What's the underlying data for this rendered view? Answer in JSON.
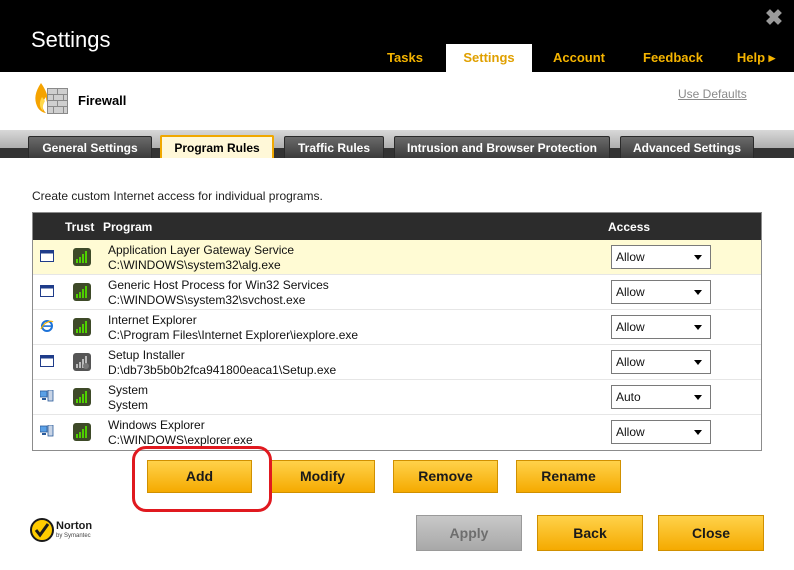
{
  "window": {
    "title": "Settings"
  },
  "top_tabs": [
    {
      "label": "Tasks"
    },
    {
      "label": "Settings"
    },
    {
      "label": "Account"
    },
    {
      "label": "Feedback"
    },
    {
      "label": "Help ▸"
    }
  ],
  "header": {
    "title": "Firewall",
    "use_defaults": "Use Defaults"
  },
  "sub_tabs": [
    {
      "label": "General Settings"
    },
    {
      "label": "Program Rules"
    },
    {
      "label": "Traffic Rules"
    },
    {
      "label": "Intrusion and Browser Protection"
    },
    {
      "label": "Advanced Settings"
    }
  ],
  "intro": "Create custom Internet access for individual programs.",
  "table": {
    "headers": {
      "trust": "Trust",
      "program": "Program",
      "access": "Access"
    },
    "rows": [
      {
        "name": "Application Layer Gateway Service",
        "path": "C:\\WINDOWS\\system32\\alg.exe",
        "access": "Allow",
        "icon": "window-icon"
      },
      {
        "name": "Generic Host Process for Win32 Services",
        "path": "C:\\WINDOWS\\system32\\svchost.exe",
        "access": "Allow",
        "icon": "window-icon"
      },
      {
        "name": "Internet Explorer",
        "path": "C:\\Program Files\\Internet Explorer\\iexplore.exe",
        "access": "Allow",
        "icon": "internet-explorer-icon"
      },
      {
        "name": "Setup Installer",
        "path": "D:\\db73b5b0b2fca941800eaca1\\Setup.exe",
        "access": "Allow",
        "icon": "window-icon"
      },
      {
        "name": "System",
        "path": "System",
        "access": "Auto",
        "icon": "computer-icon"
      },
      {
        "name": "Windows Explorer",
        "path": "C:\\WINDOWS\\explorer.exe",
        "access": "Allow",
        "icon": "computer-icon"
      }
    ]
  },
  "actions": {
    "add": "Add",
    "modify": "Modify",
    "remove": "Remove",
    "rename": "Rename"
  },
  "footer": {
    "apply": "Apply",
    "back": "Back",
    "close": "Close"
  },
  "brand": {
    "name": "Norton",
    "sub": "by Symantec"
  },
  "colors": {
    "accent": "#f5b400",
    "highlight": "#e0191f"
  }
}
